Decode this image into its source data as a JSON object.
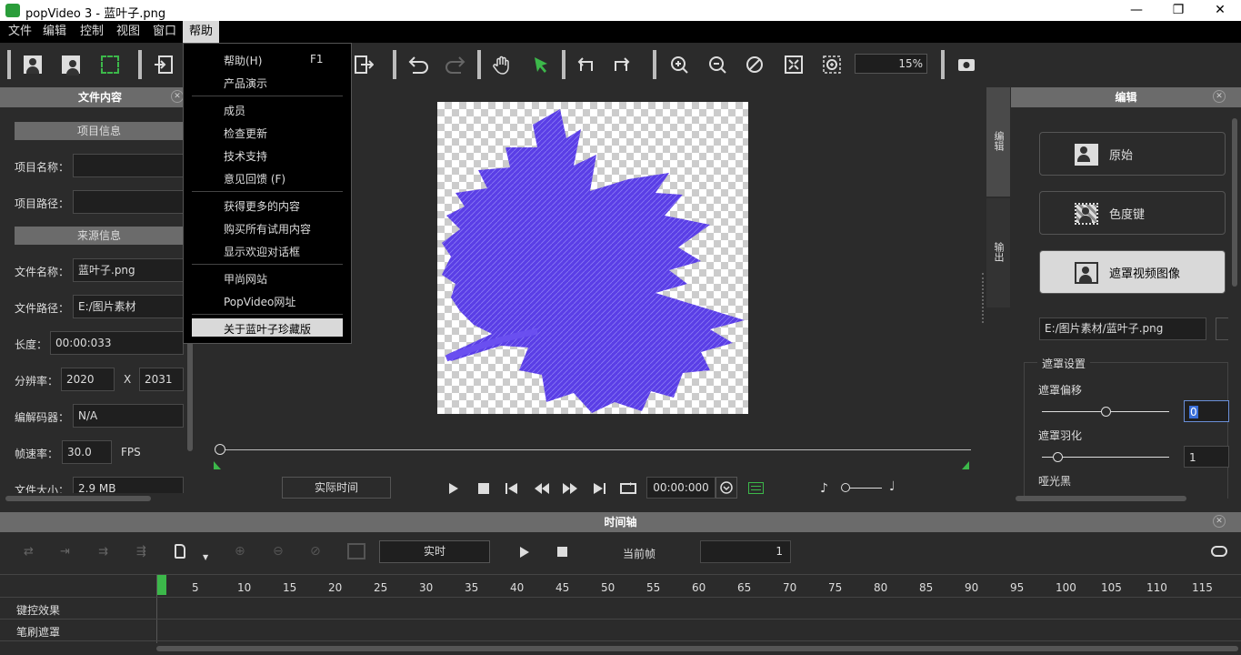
{
  "window": {
    "title": "popVideo 3 - 蓝叶子.png",
    "minimize": "—",
    "restore": "❐",
    "close": "✕"
  },
  "menu": [
    "文件",
    "编辑",
    "控制",
    "视图",
    "窗口",
    "帮助"
  ],
  "dropdown": {
    "items": [
      {
        "label": "帮助(H)",
        "shortcut": "F1"
      },
      {
        "label": "产品演示"
      },
      {
        "label": "成员"
      },
      {
        "label": "检查更新"
      },
      {
        "label": "技术支持"
      },
      {
        "label": "意见回馈 (F)"
      },
      {
        "label": "获得更多的内容"
      },
      {
        "label": "购买所有试用内容"
      },
      {
        "label": "显示欢迎对话框"
      },
      {
        "label": "甲尚网站"
      },
      {
        "label": "PopVideo网址"
      },
      {
        "label": "关于蓝叶子珍藏版"
      }
    ]
  },
  "toolbar": {
    "zoom": "15%"
  },
  "left": {
    "header": "文件内容",
    "project_section": "项目信息",
    "project_name_label": "项目名称：",
    "project_path_label": "项目路径：",
    "source_section": "来源信息",
    "file_name_label": "文件名称：",
    "file_name": "蓝叶子.png",
    "file_path_label": "文件路径：",
    "file_path": "E:/图片素材",
    "length_label": "长度：",
    "length": "00:00:033",
    "resolution_label": "分辨率：",
    "res_w": "2020",
    "res_x": "X",
    "res_h": "2031",
    "codec_label": "编解码器：",
    "codec": "N/A",
    "fps_label": "帧速率：",
    "fps": "30.0",
    "fps_unit": "FPS",
    "filesize_label": "文件大小：",
    "filesize": "2.9 MB"
  },
  "preview": {
    "realtime_btn": "实际时间",
    "timecode": "00:00:000"
  },
  "right": {
    "header": "编辑",
    "tab1": "编辑",
    "tab2": "输出",
    "opt_original": "原始",
    "opt_chroma": "色度键",
    "opt_mask": "遮罩视频图像",
    "mask_path": "E:/图片素材/蓝叶子.png",
    "mask_settings": "遮罩设置",
    "mask_offset_label": "遮罩偏移",
    "mask_offset_value": "0",
    "mask_feather_label": "遮罩羽化",
    "mask_feather_value": "1",
    "dark_label": "哑光黑"
  },
  "timeline": {
    "header": "时间轴",
    "realtime": "实时",
    "current_frame_label": "当前帧",
    "current_frame": "1",
    "ticks": [
      "5",
      "10",
      "15",
      "20",
      "25",
      "30",
      "35",
      "40",
      "45",
      "50",
      "55",
      "60",
      "65",
      "70",
      "75",
      "80",
      "85",
      "90",
      "95",
      "100",
      "105",
      "110",
      "115"
    ],
    "tracks": [
      "键控效果",
      "笔刷遮罩"
    ]
  }
}
